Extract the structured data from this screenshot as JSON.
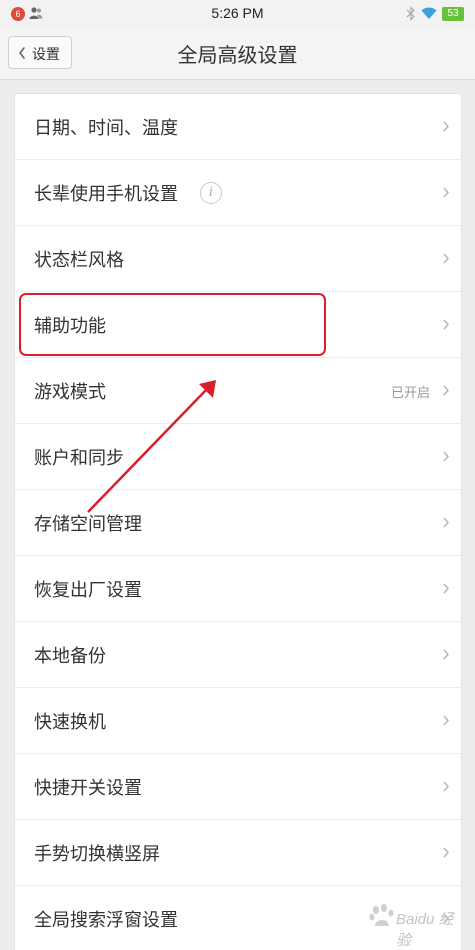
{
  "status_bar": {
    "notification_count": "6",
    "time": "5:26 PM",
    "battery": "53"
  },
  "header": {
    "back_label": "设置",
    "title": "全局高级设置"
  },
  "settings": [
    {
      "label": "日期、时间、温度",
      "value": ""
    },
    {
      "label": "长辈使用手机设置",
      "value": "",
      "info_icon": "i"
    },
    {
      "label": "状态栏风格",
      "value": ""
    },
    {
      "label": "辅助功能",
      "value": "",
      "highlighted": true
    },
    {
      "label": "游戏模式",
      "value": "已开启"
    },
    {
      "label": "账户和同步",
      "value": ""
    },
    {
      "label": "存储空间管理",
      "value": ""
    },
    {
      "label": "恢复出厂设置",
      "value": ""
    },
    {
      "label": "本地备份",
      "value": ""
    },
    {
      "label": "快速换机",
      "value": ""
    },
    {
      "label": "快捷开关设置",
      "value": ""
    },
    {
      "label": "手势切换横竖屏",
      "value": ""
    },
    {
      "label": "全局搜索浮窗设置",
      "value": ""
    }
  ],
  "annotation": {
    "highlight_color": "#d8202a",
    "arrow_color": "#d8202a"
  },
  "watermark": {
    "text": "Baidu 经验"
  },
  "colors": {
    "background": "#ededed",
    "battery": "#67c13a",
    "badge": "#e04a3b"
  }
}
